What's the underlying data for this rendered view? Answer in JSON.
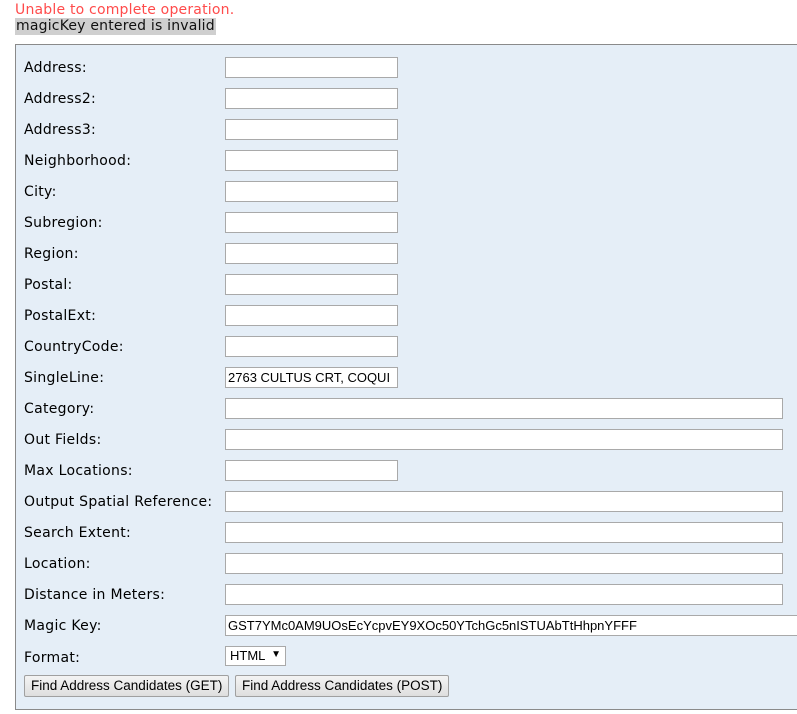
{
  "error": {
    "message": "Unable to complete operation.",
    "detail": "magicKey entered is invalid"
  },
  "form": {
    "fields": [
      {
        "label": "Address:",
        "value": ""
      },
      {
        "label": "Address2:",
        "value": ""
      },
      {
        "label": "Address3:",
        "value": ""
      },
      {
        "label": "Neighborhood:",
        "value": ""
      },
      {
        "label": "City:",
        "value": ""
      },
      {
        "label": "Subregion:",
        "value": ""
      },
      {
        "label": "Region:",
        "value": ""
      },
      {
        "label": "Postal:",
        "value": ""
      },
      {
        "label": "PostalExt:",
        "value": ""
      },
      {
        "label": "CountryCode:",
        "value": ""
      },
      {
        "label": "SingleLine:",
        "value": "2763 CULTUS CRT, COQUI"
      },
      {
        "label": "Category:",
        "value": ""
      },
      {
        "label": "Out Fields:",
        "value": ""
      },
      {
        "label": "Max Locations:",
        "value": ""
      },
      {
        "label": "Output Spatial Reference:",
        "value": ""
      },
      {
        "label": "Search Extent:",
        "value": ""
      },
      {
        "label": "Location:",
        "value": ""
      },
      {
        "label": "Distance in Meters:",
        "value": ""
      },
      {
        "label": "Magic Key:",
        "value": "GST7YMc0AM9UOsEcYcpvEY9XOc50YTchGc5nISTUAbTtHhpnYFFF"
      }
    ],
    "format": {
      "label": "Format:",
      "selected": "HTML"
    },
    "buttons": {
      "get": "Find Address Candidates (GET)",
      "post": "Find Address Candidates (POST)"
    }
  }
}
